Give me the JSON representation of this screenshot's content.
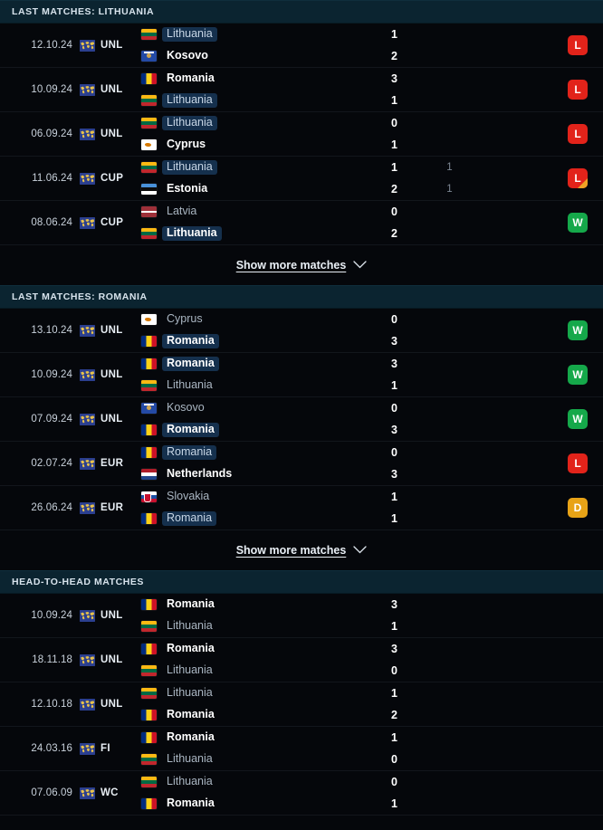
{
  "sections": [
    {
      "id": "last-matches-lithuania",
      "title": "LAST MATCHES: LITHUANIA",
      "show_more_label": "Show more matches",
      "matches": [
        {
          "date": "12.10.24",
          "competition": "UNL",
          "competition_icon": "globe-icon",
          "home": {
            "team": "Lithuania",
            "flag": "lt",
            "score": "1",
            "subscore": "",
            "winner": false,
            "highlight": true
          },
          "away": {
            "team": "Kosovo",
            "flag": "xk",
            "score": "2",
            "subscore": "",
            "winner": true,
            "highlight": false
          },
          "result": "L",
          "result_color": "#e2231a",
          "extra": false
        },
        {
          "date": "10.09.24",
          "competition": "UNL",
          "competition_icon": "globe-icon",
          "home": {
            "team": "Romania",
            "flag": "ro",
            "score": "3",
            "subscore": "",
            "winner": true,
            "highlight": false
          },
          "away": {
            "team": "Lithuania",
            "flag": "lt",
            "score": "1",
            "subscore": "",
            "winner": false,
            "highlight": true
          },
          "result": "L",
          "result_color": "#e2231a",
          "extra": false
        },
        {
          "date": "06.09.24",
          "competition": "UNL",
          "competition_icon": "globe-icon",
          "home": {
            "team": "Lithuania",
            "flag": "lt",
            "score": "0",
            "subscore": "",
            "winner": false,
            "highlight": true
          },
          "away": {
            "team": "Cyprus",
            "flag": "cy",
            "score": "1",
            "subscore": "",
            "winner": true,
            "highlight": false
          },
          "result": "L",
          "result_color": "#e2231a",
          "extra": false
        },
        {
          "date": "11.06.24",
          "competition": "CUP",
          "competition_icon": "globe-icon",
          "home": {
            "team": "Lithuania",
            "flag": "lt",
            "score": "1",
            "subscore": "1",
            "winner": false,
            "highlight": true
          },
          "away": {
            "team": "Estonia",
            "flag": "ee",
            "score": "2",
            "subscore": "1",
            "winner": true,
            "highlight": false
          },
          "result": "L",
          "result_color": "#e2231a",
          "extra": true
        },
        {
          "date": "08.06.24",
          "competition": "CUP",
          "competition_icon": "globe-icon",
          "home": {
            "team": "Latvia",
            "flag": "lv",
            "score": "0",
            "subscore": "",
            "winner": false,
            "highlight": false
          },
          "away": {
            "team": "Lithuania",
            "flag": "lt",
            "score": "2",
            "subscore": "",
            "winner": true,
            "highlight": true
          },
          "result": "W",
          "result_color": "#15a84a",
          "extra": false
        }
      ]
    },
    {
      "id": "last-matches-romania",
      "title": "LAST MATCHES: ROMANIA",
      "show_more_label": "Show more matches",
      "matches": [
        {
          "date": "13.10.24",
          "competition": "UNL",
          "competition_icon": "globe-icon",
          "home": {
            "team": "Cyprus",
            "flag": "cy",
            "score": "0",
            "subscore": "",
            "winner": false,
            "highlight": false
          },
          "away": {
            "team": "Romania",
            "flag": "ro",
            "score": "3",
            "subscore": "",
            "winner": true,
            "highlight": true
          },
          "result": "W",
          "result_color": "#15a84a",
          "extra": false
        },
        {
          "date": "10.09.24",
          "competition": "UNL",
          "competition_icon": "globe-icon",
          "home": {
            "team": "Romania",
            "flag": "ro",
            "score": "3",
            "subscore": "",
            "winner": true,
            "highlight": true
          },
          "away": {
            "team": "Lithuania",
            "flag": "lt",
            "score": "1",
            "subscore": "",
            "winner": false,
            "highlight": false
          },
          "result": "W",
          "result_color": "#15a84a",
          "extra": false
        },
        {
          "date": "07.09.24",
          "competition": "UNL",
          "competition_icon": "globe-icon",
          "home": {
            "team": "Kosovo",
            "flag": "xk",
            "score": "0",
            "subscore": "",
            "winner": false,
            "highlight": false
          },
          "away": {
            "team": "Romania",
            "flag": "ro",
            "score": "3",
            "subscore": "",
            "winner": true,
            "highlight": true
          },
          "result": "W",
          "result_color": "#15a84a",
          "extra": false
        },
        {
          "date": "02.07.24",
          "competition": "EUR",
          "competition_icon": "globe-icon",
          "home": {
            "team": "Romania",
            "flag": "ro",
            "score": "0",
            "subscore": "",
            "winner": false,
            "highlight": true
          },
          "away": {
            "team": "Netherlands",
            "flag": "nl",
            "score": "3",
            "subscore": "",
            "winner": true,
            "highlight": false
          },
          "result": "L",
          "result_color": "#e2231a",
          "extra": false
        },
        {
          "date": "26.06.24",
          "competition": "EUR",
          "competition_icon": "globe-icon",
          "home": {
            "team": "Slovakia",
            "flag": "sk",
            "score": "1",
            "subscore": "",
            "winner": false,
            "highlight": false
          },
          "away": {
            "team": "Romania",
            "flag": "ro",
            "score": "1",
            "subscore": "",
            "winner": false,
            "highlight": true
          },
          "result": "D",
          "result_color": "#e8a317",
          "extra": false
        }
      ]
    },
    {
      "id": "head-to-head-matches",
      "title": "HEAD-TO-HEAD MATCHES",
      "show_more_label": "",
      "matches": [
        {
          "date": "10.09.24",
          "competition": "UNL",
          "competition_icon": "globe-icon",
          "home": {
            "team": "Romania",
            "flag": "ro",
            "score": "3",
            "subscore": "",
            "winner": true,
            "highlight": false
          },
          "away": {
            "team": "Lithuania",
            "flag": "lt",
            "score": "1",
            "subscore": "",
            "winner": false,
            "highlight": false
          },
          "result": "",
          "result_color": "",
          "extra": false
        },
        {
          "date": "18.11.18",
          "competition": "UNL",
          "competition_icon": "globe-icon",
          "home": {
            "team": "Romania",
            "flag": "ro",
            "score": "3",
            "subscore": "",
            "winner": true,
            "highlight": false
          },
          "away": {
            "team": "Lithuania",
            "flag": "lt",
            "score": "0",
            "subscore": "",
            "winner": false,
            "highlight": false
          },
          "result": "",
          "result_color": "",
          "extra": false
        },
        {
          "date": "12.10.18",
          "competition": "UNL",
          "competition_icon": "globe-icon",
          "home": {
            "team": "Lithuania",
            "flag": "lt",
            "score": "1",
            "subscore": "",
            "winner": false,
            "highlight": false
          },
          "away": {
            "team": "Romania",
            "flag": "ro",
            "score": "2",
            "subscore": "",
            "winner": true,
            "highlight": false
          },
          "result": "",
          "result_color": "",
          "extra": false
        },
        {
          "date": "24.03.16",
          "competition": "FI",
          "competition_icon": "globe-icon",
          "home": {
            "team": "Romania",
            "flag": "ro",
            "score": "1",
            "subscore": "",
            "winner": true,
            "highlight": false
          },
          "away": {
            "team": "Lithuania",
            "flag": "lt",
            "score": "0",
            "subscore": "",
            "winner": false,
            "highlight": false
          },
          "result": "",
          "result_color": "",
          "extra": false
        },
        {
          "date": "07.06.09",
          "competition": "WC",
          "competition_icon": "globe-icon",
          "home": {
            "team": "Lithuania",
            "flag": "lt",
            "score": "0",
            "subscore": "",
            "winner": false,
            "highlight": false
          },
          "away": {
            "team": "Romania",
            "flag": "ro",
            "score": "1",
            "subscore": "",
            "winner": true,
            "highlight": false
          },
          "result": "",
          "result_color": "",
          "extra": false
        }
      ]
    }
  ],
  "icons": {
    "chevron_down": "chevron-down-icon",
    "globe": "globe-icon"
  },
  "colors": {
    "background": "#05070b",
    "section_header": "#0b2430",
    "highlight": "#15304d",
    "win": "#15a84a",
    "loss": "#e2231a",
    "draw": "#e8a317",
    "extra_time": "#f0a124"
  }
}
